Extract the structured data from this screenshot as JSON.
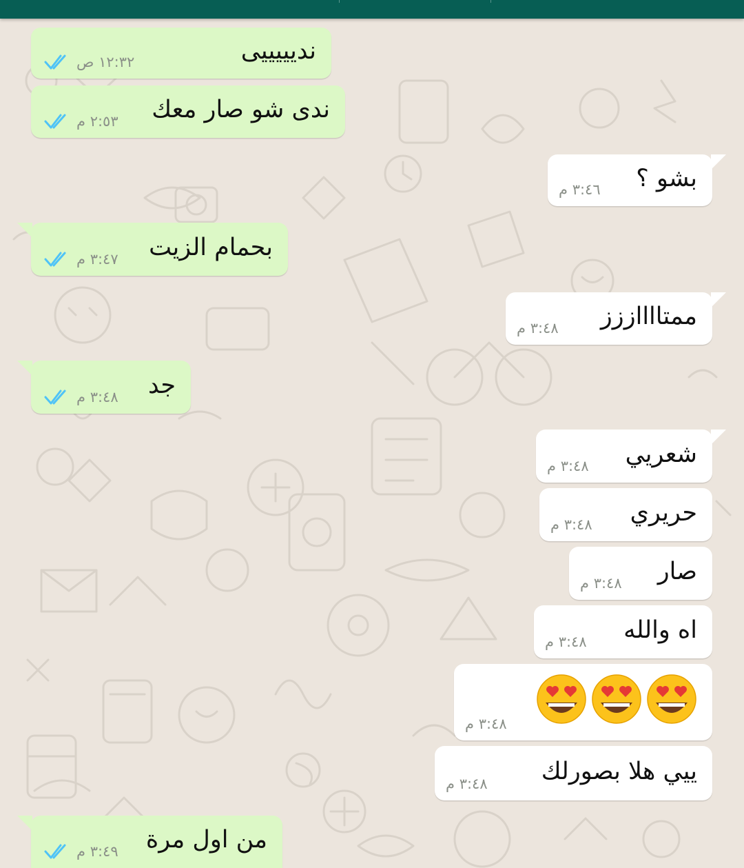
{
  "messages": [
    {
      "text": "نديييييى",
      "time": "١٢:٣٢ ص"
    },
    {
      "text": "ندى شو صار معك",
      "time": "٢:٥٣ م"
    },
    {
      "text": "بشو ؟",
      "time": "٣:٤٦ م"
    },
    {
      "text": "بحمام الزيت",
      "time": "٣:٤٧ م"
    },
    {
      "text": "ممتااااززز",
      "time": "٣:٤٨ م"
    },
    {
      "text": "جد",
      "time": "٣:٤٨ م"
    },
    {
      "text": "شعريي",
      "time": "٣:٤٨ م"
    },
    {
      "text": "حريري",
      "time": "٣:٤٨ م"
    },
    {
      "text": "صار",
      "time": "٣:٤٨ م"
    },
    {
      "text": "اه والله",
      "time": "٣:٤٨ م"
    },
    {
      "text": "",
      "time": "٣:٤٨ م",
      "emoji": [
        "heart-eyes-emoji",
        "heart-eyes-emoji",
        "heart-eyes-emoji"
      ]
    },
    {
      "text": "ييي هلا بصورلك",
      "time": "٣:٤٨ م"
    },
    {
      "text": "من اول مرة",
      "time": "٣:٤٩ م"
    }
  ],
  "colors": {
    "header": "#075e54",
    "outgoing_bubble": "#dcf8c6",
    "incoming_bubble": "#ffffff",
    "chat_background": "#ece5dd",
    "read_ticks": "#4fc3f7",
    "timestamp": "#8a8f88"
  },
  "icons": {
    "read_receipt": "double-check-icon",
    "emoji": "heart-eyes-emoji"
  }
}
